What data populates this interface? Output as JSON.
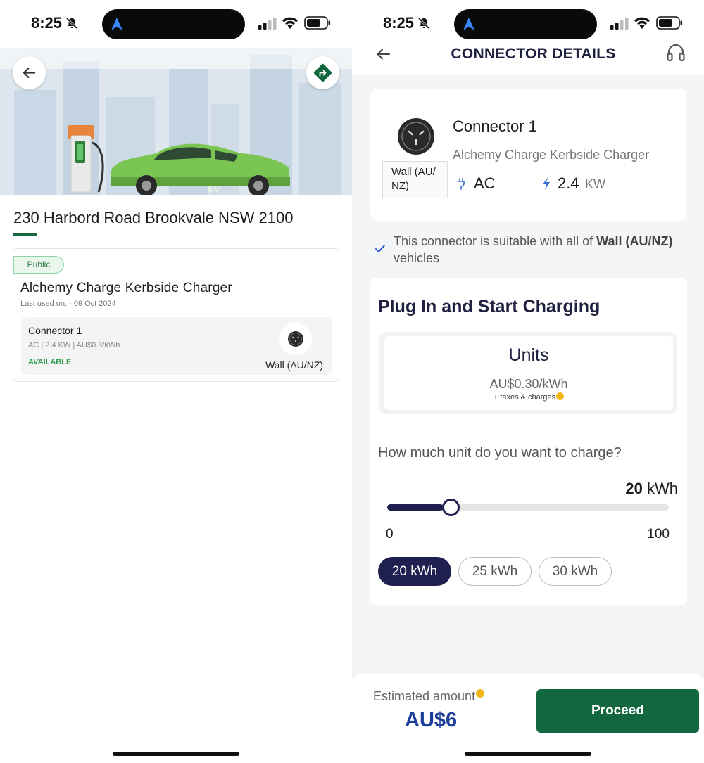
{
  "left_screen": {
    "status_bar": {
      "time": "8:25"
    },
    "address": "230 Harbord Road Brookvale NSW 2100",
    "hero": {
      "car_label": "EV"
    },
    "station": {
      "badge": "Public",
      "name": "Alchemy Charge Kerbside Charger",
      "last_used": "Last used on. - 09 Oct 2024",
      "connector": {
        "title": "Connector 1",
        "meta": "AC | 2.4 KW | AU$0.3/kWh",
        "status": "AVAILABLE",
        "plug_type": "Wall (AU/NZ)"
      }
    }
  },
  "right_screen": {
    "status_bar": {
      "time": "8:25"
    },
    "header": {
      "title": "CONNECTOR DETAILS"
    },
    "connector": {
      "name": "Connector 1",
      "station": "Alchemy Charge Kerbside Charger",
      "type_line1": "Wall (AU/",
      "type_line2": "NZ)",
      "current": "AC",
      "power_value": "2.4",
      "power_unit": "KW"
    },
    "compat": {
      "prefix": "This connector is suitable with all of ",
      "bold": "Wall (AU/NZ)",
      "suffix": " vehicles"
    },
    "charging": {
      "heading": "Plug In and Start Charging",
      "units_title": "Units",
      "units_price": "AU$0.30/kWh",
      "units_taxes": "+ taxes & charges",
      "question": "How much unit do you want to charge?",
      "amount_value": "20",
      "amount_unit": "kWh",
      "slider": {
        "min": "0",
        "max": "100",
        "value": 20
      },
      "chips": [
        {
          "label": "20 kWh",
          "selected": true
        },
        {
          "label": "25 kWh",
          "selected": false
        },
        {
          "label": "30 kWh",
          "selected": false
        }
      ]
    },
    "footer": {
      "estimated_label": "Estimated amount",
      "estimated_value": "AU$6",
      "proceed_label": "Proceed"
    }
  },
  "colors": {
    "brand_green": "#13673f",
    "navy": "#202050",
    "status_green": "#2b9b4a",
    "price_blue": "#1d3f9a",
    "info_yellow": "#f2b61c"
  },
  "icons": [
    "bell-slash-icon",
    "navigation-arrow-icon",
    "signal-icon",
    "wifi-icon",
    "battery-icon",
    "back-arrow-icon",
    "directions-icon",
    "headset-icon",
    "socket-icon",
    "ac-plug-icon",
    "bolt-icon",
    "check-icon",
    "info-icon"
  ]
}
